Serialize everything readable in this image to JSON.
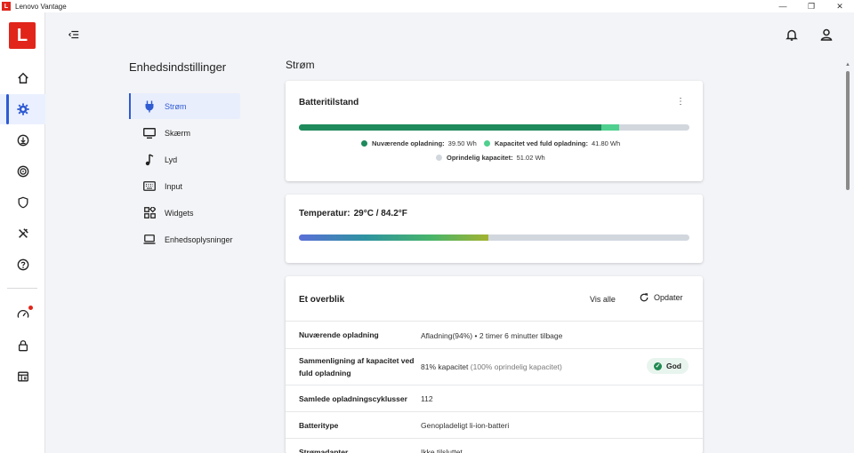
{
  "titlebar": {
    "title": "Lenovo Vantage",
    "logo": "L",
    "minimize": "—",
    "maximize": "❐",
    "close": "✕"
  },
  "rail": {
    "logo": "L",
    "items": [
      {
        "name": "home-icon"
      },
      {
        "name": "gear-icon"
      },
      {
        "name": "download-icon"
      },
      {
        "name": "radar-icon"
      },
      {
        "name": "shield-icon"
      },
      {
        "name": "tools-icon"
      },
      {
        "name": "help-icon"
      },
      {
        "name": "speedometer-icon"
      },
      {
        "name": "lock-icon"
      },
      {
        "name": "dashboard-icon"
      }
    ]
  },
  "nav": {
    "title": "Enhedsindstillinger",
    "items": [
      {
        "label": "Strøm",
        "icon": "plug-icon"
      },
      {
        "label": "Skærm",
        "icon": "monitor-icon"
      },
      {
        "label": "Lyd",
        "icon": "music-icon"
      },
      {
        "label": "Input",
        "icon": "keyboard-icon"
      },
      {
        "label": "Widgets",
        "icon": "widgets-icon"
      },
      {
        "label": "Enhedsoplysninger",
        "icon": "laptop-icon"
      }
    ]
  },
  "section_title": "Strøm",
  "battery_card": {
    "title": "Batteritilstand",
    "current_label": "Nuværende opladning:",
    "current_value": "39.50 Wh",
    "full_label": "Kapacitet ved fuld opladning:",
    "full_value": "41.80 Wh",
    "orig_label": "Oprindelig kapacitet:",
    "orig_value": "51.02 Wh",
    "current_wh": 39.5,
    "full_wh": 41.8,
    "orig_wh": 51.02,
    "colors": {
      "current": "#1f8a5b",
      "full": "#4fd08e",
      "original": "#d2d7de"
    }
  },
  "temperature_card": {
    "label": "Temperatur:",
    "value": "29°C / 84.2°F",
    "level_fraction": 0.485
  },
  "overview": {
    "title": "Et overblik",
    "view_all": "Vis alle",
    "refresh": "Opdater",
    "rows": [
      {
        "key": "Nuværende opladning",
        "value": "Afladning(94%)  •  2 timer 6 minutter tilbage"
      },
      {
        "key": "Sammenligning af kapacitet ved fuld opladning",
        "value": "81% kapacitet",
        "muted": "(100% oprindelig kapacitet)",
        "badge": "God"
      },
      {
        "key": "Samlede opladningscyklusser",
        "value": "112"
      },
      {
        "key": "Batteritype",
        "value": "Genopladeligt li-ion-batteri"
      },
      {
        "key": "Strømadapter",
        "value": "Ikke tilsluttet"
      }
    ]
  }
}
